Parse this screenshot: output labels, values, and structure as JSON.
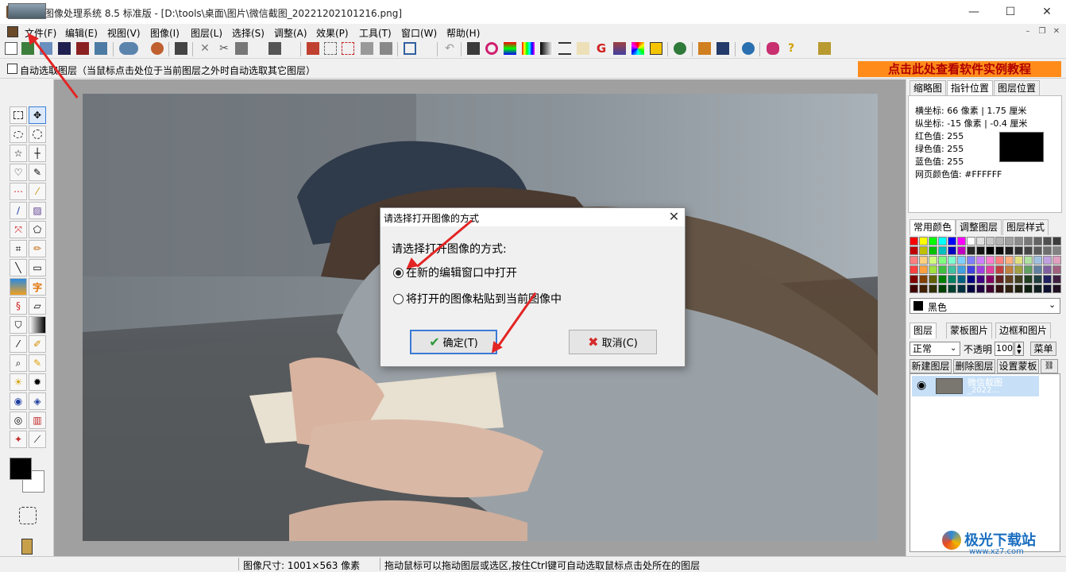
{
  "window": {
    "title": "友锋图像处理系统 8.5 标准版 - [D:\\tools\\桌面\\图片\\微信截图_20221202101216.png]",
    "minimize": "—",
    "maximize": "☐",
    "close": "✕"
  },
  "menu": {
    "items": [
      "文件(F)",
      "编辑(E)",
      "视图(V)",
      "图像(I)",
      "图层(L)",
      "选择(S)",
      "调整(A)",
      "效果(P)",
      "工具(T)",
      "窗口(W)",
      "帮助(H)"
    ],
    "mdi_min": "–",
    "mdi_restore": "❐",
    "mdi_close": "✕"
  },
  "optionbar": {
    "auto_select_label": "自动选取图层（当鼠标点击处位于当前图层之外时自动选取其它图层）",
    "tutorial": "点击此处查看软件实例教程"
  },
  "right_panel": {
    "tabs_top": [
      "缩略图",
      "指针位置",
      "图层位置"
    ],
    "info": {
      "x_coord": "横坐标: 66 像素 | 1.75 厘米",
      "y_coord": "纵坐标: -15 像素 | -0.4 厘米",
      "red": "红色值: 255",
      "green": "绿色值: 255",
      "blue": "蓝色值: 255",
      "web_color": "网页颜色值: #FFFFFF"
    },
    "tabs_mid": [
      "常用颜色",
      "调整图层",
      "图层样式"
    ],
    "color_select": "黑色",
    "tabs_bottom": [
      "图层",
      "蒙板图片",
      "边框和图片"
    ],
    "blend_mode": "正常",
    "opacity_label": "不透明",
    "opacity_value": "100",
    "menu_button": "菜单",
    "new_layer": "新建图层",
    "delete_layer": "删除图层",
    "set_mask": "设置蒙板",
    "layer_name_1": "微信截图",
    "layer_name_2": "_2022..."
  },
  "dialog": {
    "title": "请选择打开图像的方式",
    "close": "✕",
    "prompt": "请选择打开图像的方式:",
    "option_new_window": "在新的编辑窗口中打开",
    "option_paste": "将打开的图像粘贴到当前图像中",
    "selected": "option_new_window",
    "ok": "确定(T)",
    "cancel": "取消(C)"
  },
  "status": {
    "image_size": "图像尺寸: 1001×563 像素",
    "hint": "拖动鼠标可以拖动图层或选区,按住Ctrl键可自动选取鼠标点击处所在的图层"
  },
  "watermark": {
    "name": "极光下载站",
    "url": "www.xz7.com"
  },
  "colors": {
    "accent_red": "#e32424",
    "tutorial_bg": "#ff8c1a",
    "layer_selected": "#c7e0f8",
    "dialog_focus": "#3b7ad6"
  }
}
